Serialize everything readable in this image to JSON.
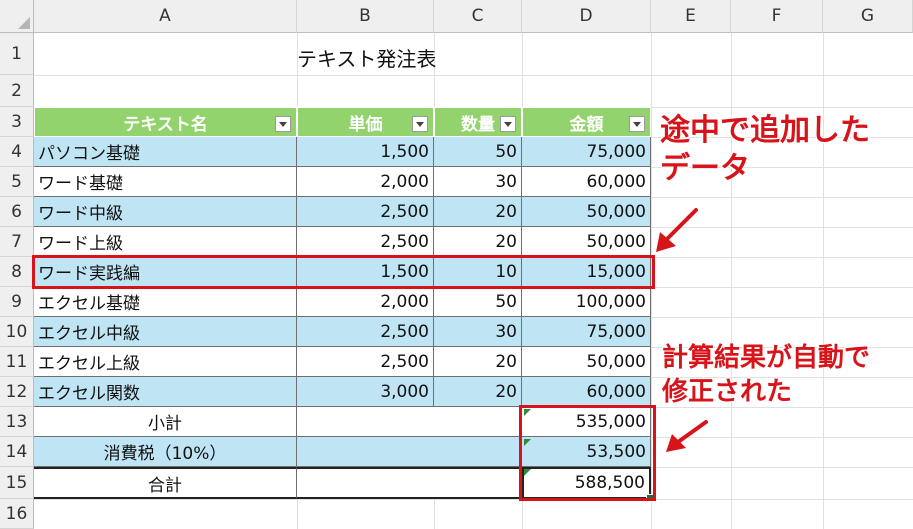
{
  "columns": [
    "A",
    "B",
    "C",
    "D",
    "E",
    "F",
    "G"
  ],
  "rows": [
    "1",
    "2",
    "3",
    "4",
    "5",
    "6",
    "7",
    "8",
    "9",
    "10",
    "11",
    "12",
    "13",
    "14",
    "15",
    "16"
  ],
  "title": "テキスト発注表",
  "table": {
    "headers": [
      "テキスト名",
      "単価",
      "数量",
      "金額"
    ],
    "data": [
      [
        "パソコン基礎",
        "1,500",
        "50",
        "75,000"
      ],
      [
        "ワード基礎",
        "2,000",
        "30",
        "60,000"
      ],
      [
        "ワード中級",
        "2,500",
        "20",
        "50,000"
      ],
      [
        "ワード上級",
        "2,500",
        "20",
        "50,000"
      ],
      [
        "ワード実践編",
        "1,500",
        "10",
        "15,000"
      ],
      [
        "エクセル基礎",
        "2,000",
        "50",
        "100,000"
      ],
      [
        "エクセル中級",
        "2,500",
        "30",
        "75,000"
      ],
      [
        "エクセル上級",
        "2,500",
        "20",
        "50,000"
      ],
      [
        "エクセル関数",
        "3,000",
        "20",
        "60,000"
      ]
    ],
    "summary": [
      {
        "label": "小計",
        "value": "535,000"
      },
      {
        "label": "消費税（10%）",
        "value": "53,500"
      },
      {
        "label": "合計",
        "value": "588,500"
      }
    ]
  },
  "annotations": {
    "added_line1": "途中で追加した",
    "added_line2": "データ",
    "calc_line1": "計算結果が自動で",
    "calc_line2": "修正された"
  },
  "colors": {
    "header_green": "#92d36e",
    "band_blue": "#bfe4f3",
    "highlight_red": "#d8141b"
  }
}
